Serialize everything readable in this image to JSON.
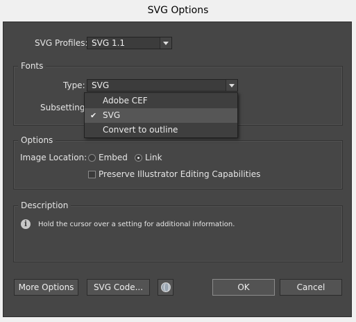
{
  "window": {
    "title": "SVG Options"
  },
  "profiles": {
    "label": "SVG Profiles:",
    "value": "SVG 1.1"
  },
  "fonts": {
    "title": "Fonts",
    "type_label": "Type:",
    "type_value": "SVG",
    "subsetting_label": "Subsetting:",
    "dropdown_items": [
      "Adobe CEF",
      "SVG",
      "Convert to outline"
    ],
    "selected_index": 1
  },
  "options": {
    "title": "Options",
    "image_location_label": "Image Location:",
    "embed_label": "Embed",
    "link_label": "Link",
    "selected": "Link",
    "preserve_label": "Preserve Illustrator Editing Capabilities",
    "preserve_checked": false
  },
  "description": {
    "title": "Description",
    "text": "Hold the cursor over a setting for additional information."
  },
  "buttons": {
    "more_options": "More Options",
    "svg_code": "SVG Code...",
    "ok": "OK",
    "cancel": "Cancel"
  }
}
